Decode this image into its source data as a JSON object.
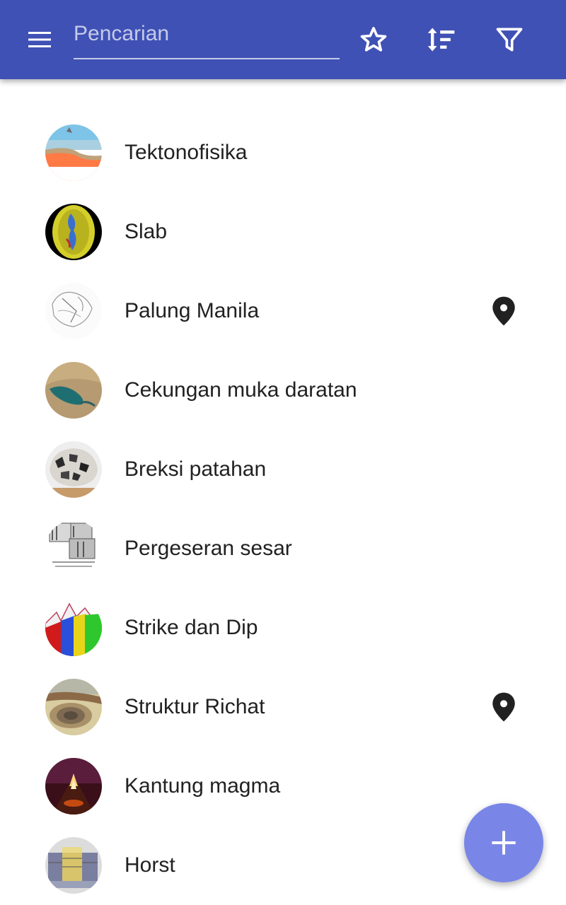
{
  "search": {
    "placeholder": "Pencarian",
    "value": ""
  },
  "toolbar": {
    "menu_icon": "menu-icon",
    "favorite_icon": "star-outline-icon",
    "sort_icon": "sort-icon",
    "filter_icon": "filter-icon",
    "background_color": "#3f51b5"
  },
  "items": [
    {
      "label": "Tektonofisika",
      "thumb": "plate-cross-section",
      "has_location": false
    },
    {
      "label": "Slab",
      "thumb": "slab-globe",
      "has_location": false
    },
    {
      "label": "Palung Manila",
      "thumb": "sketch-map",
      "has_location": true
    },
    {
      "label": "Cekungan muka daratan",
      "thumb": "satellite-basin",
      "has_location": false
    },
    {
      "label": "Breksi patahan",
      "thumb": "breccia-rock",
      "has_location": false
    },
    {
      "label": "Pergeseran sesar",
      "thumb": "fault-diagram",
      "has_location": false
    },
    {
      "label": "Strike dan Dip",
      "thumb": "colored-layers",
      "has_location": false
    },
    {
      "label": "Struktur Richat",
      "thumb": "richat-aerial",
      "has_location": true
    },
    {
      "label": "Kantung magma",
      "thumb": "magma-volcano",
      "has_location": false
    },
    {
      "label": "Horst",
      "thumb": "horst-block",
      "has_location": false
    }
  ],
  "fab": {
    "icon": "plus-icon",
    "color": "#7986e8"
  },
  "location_icon": "map-marker-icon"
}
